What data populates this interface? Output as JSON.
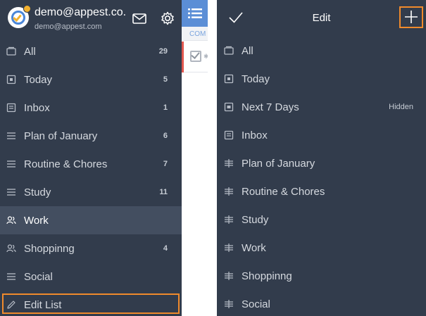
{
  "account": {
    "name": "demo@appest.co...",
    "email": "demo@appest.com"
  },
  "sidebar": {
    "items": [
      {
        "label": "All",
        "count": "29",
        "icon": "tray-icon"
      },
      {
        "label": "Today",
        "count": "5",
        "icon": "calendar-icon"
      },
      {
        "label": "Inbox",
        "count": "1",
        "icon": "inbox-icon"
      },
      {
        "label": "Plan of January",
        "count": "6",
        "icon": "list-icon"
      },
      {
        "label": "Routine & Chores",
        "count": "7",
        "icon": "list-icon"
      },
      {
        "label": "Study",
        "count": "11",
        "icon": "list-icon"
      },
      {
        "label": "Work",
        "count": "",
        "icon": "shared-users-icon",
        "active": true
      },
      {
        "label": "Shoppinng",
        "count": "4",
        "icon": "shared-users-icon"
      },
      {
        "label": "Social",
        "count": "",
        "icon": "list-icon"
      },
      {
        "label": "Edit List",
        "count": "",
        "icon": "pencil-icon",
        "highlighted": true
      }
    ]
  },
  "middle": {
    "section_label": "COM"
  },
  "edit_panel": {
    "title": "Edit",
    "items": [
      {
        "label": "All",
        "status": "",
        "icon": "tray-icon"
      },
      {
        "label": "Today",
        "status": "",
        "icon": "calendar-icon"
      },
      {
        "label": "Next 7 Days",
        "status": "Hidden",
        "icon": "calendar-icon"
      },
      {
        "label": "Inbox",
        "status": "",
        "icon": "inbox-icon"
      },
      {
        "label": "Plan of January",
        "status": "",
        "icon": "drag-handle-icon"
      },
      {
        "label": "Routine & Chores",
        "status": "",
        "icon": "drag-handle-icon"
      },
      {
        "label": "Study",
        "status": "",
        "icon": "drag-handle-icon"
      },
      {
        "label": "Work",
        "status": "",
        "icon": "drag-handle-icon"
      },
      {
        "label": "Shoppinng",
        "status": "",
        "icon": "drag-handle-icon"
      },
      {
        "label": "Social",
        "status": "",
        "icon": "drag-handle-icon"
      }
    ]
  },
  "colors": {
    "panel_bg": "#323c4c",
    "active_row": "#434e60",
    "accent_blue": "#5b8ed6",
    "highlight_orange": "#f08a2c"
  }
}
